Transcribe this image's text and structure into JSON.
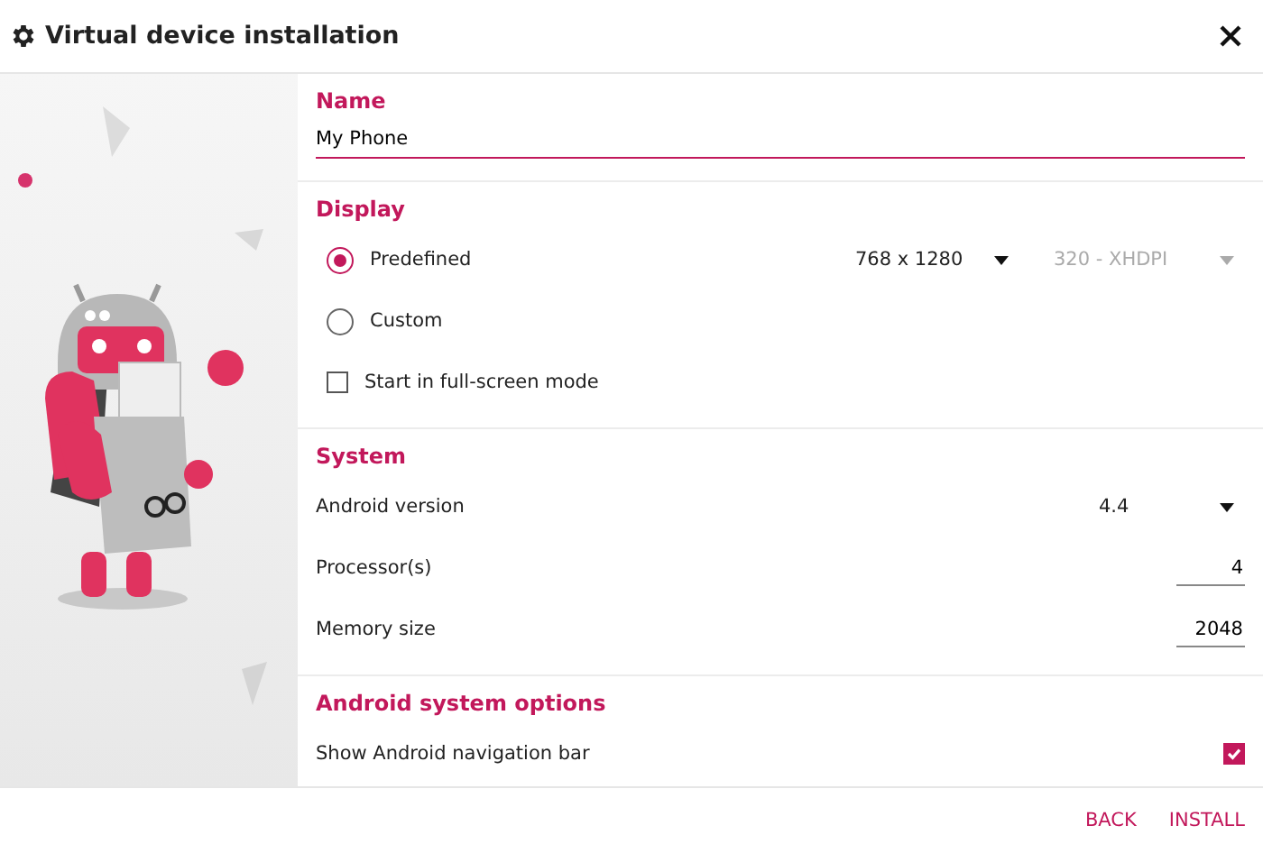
{
  "window": {
    "title": "Virtual device installation"
  },
  "name_section": {
    "title": "Name",
    "value": "My Phone"
  },
  "display": {
    "title": "Display",
    "options": [
      {
        "label": "Predefined",
        "selected": true
      },
      {
        "label": "Custom",
        "selected": false
      }
    ],
    "resolution": "768 x 1280",
    "density": {
      "value": "320 - XHDPI",
      "disabled": true
    },
    "fullscreen": {
      "label": "Start in full-screen mode",
      "checked": false
    }
  },
  "system": {
    "title": "System",
    "rows": [
      {
        "kind": "dropdown",
        "label": "Android version",
        "value": "4.4"
      },
      {
        "kind": "number",
        "label": "Processor(s)",
        "value": "4"
      },
      {
        "kind": "number",
        "label": "Memory size",
        "value": "2048"
      }
    ]
  },
  "android_options": {
    "title": "Android system options",
    "rows": [
      {
        "label": "Show Android navigation bar",
        "checked": true
      }
    ]
  },
  "buttons": [
    "BACK",
    "INSTALL"
  ]
}
